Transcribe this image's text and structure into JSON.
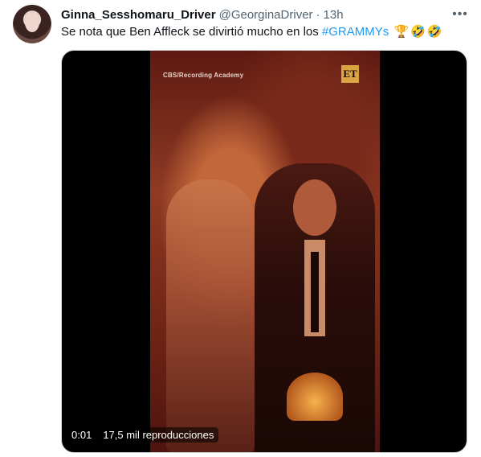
{
  "tweet": {
    "display_name": "Ginna_Sesshomaru_Driver",
    "handle": "@GeorginaDriver",
    "separator": "·",
    "time": "13h",
    "more_icon": "ellipsis-icon",
    "text_prefix": "Se nota que Ben Affleck se divirtió mucho en los ",
    "hashtag": "#GRAMMYs",
    "emojis": [
      "🏆",
      "🤣",
      "🤣"
    ]
  },
  "media": {
    "type": "video",
    "watermark": "CBS/Recording Academy",
    "logo_text": "ET",
    "elapsed": "0:01",
    "views": "17,5 mil reproducciones"
  },
  "colors": {
    "accent": "#1d9bf0",
    "secondary_text": "#536471",
    "primary_text": "#0f1419"
  }
}
